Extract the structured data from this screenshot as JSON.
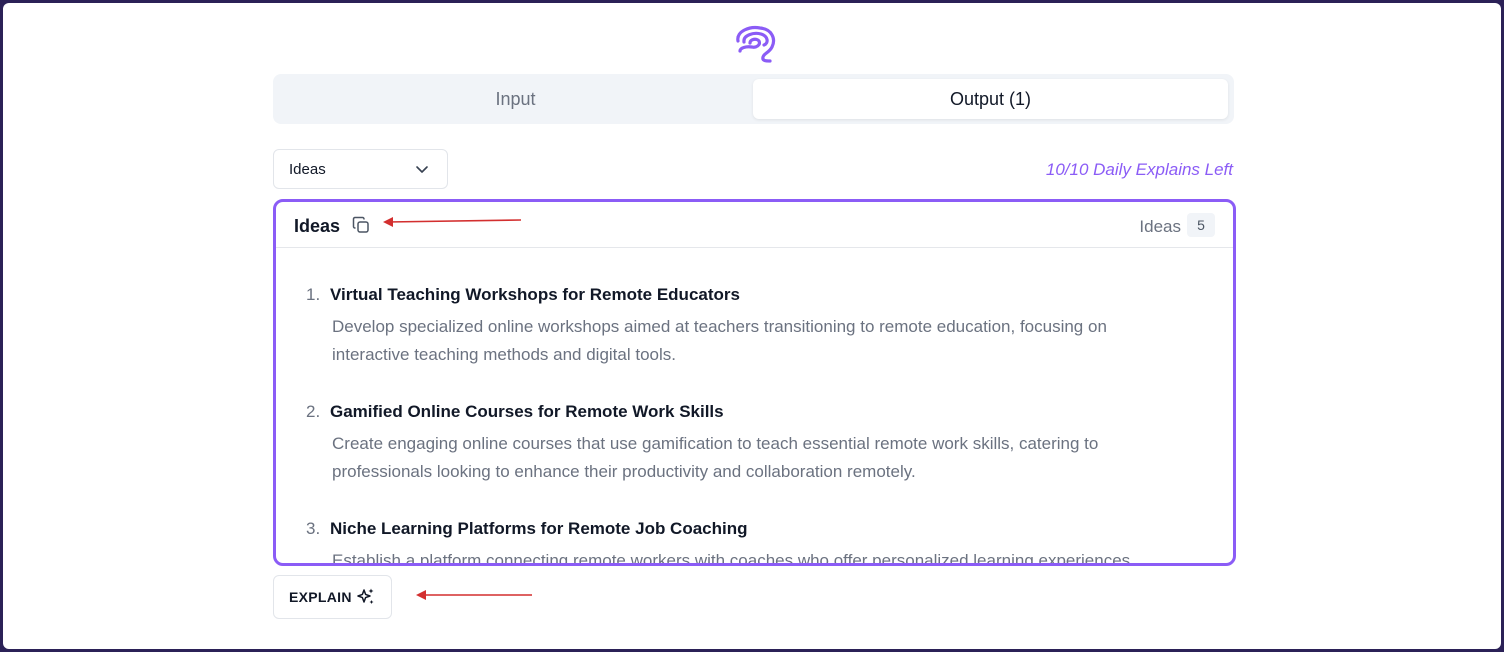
{
  "tabs": [
    {
      "label": "Input",
      "active": false
    },
    {
      "label": "Output (1)",
      "active": true
    }
  ],
  "selector": {
    "value": "Ideas"
  },
  "quota_text": "10/10 Daily Explains Left",
  "panel": {
    "title": "Ideas",
    "count_label": "Ideas",
    "count": "5",
    "items": [
      {
        "num": "1.",
        "title": "Virtual Teaching Workshops for Remote Educators",
        "desc": "Develop specialized online workshops aimed at teachers transitioning to remote education, focusing on interactive teaching methods and digital tools."
      },
      {
        "num": "2.",
        "title": "Gamified Online Courses for Remote Work Skills",
        "desc": "Create engaging online courses that use gamification to teach essential remote work skills, catering to professionals looking to enhance their productivity and collaboration remotely."
      },
      {
        "num": "3.",
        "title": "Niche Learning Platforms for Remote Job Coaching",
        "desc": "Establish a platform connecting remote workers with coaches who offer personalized learning experiences and"
      }
    ]
  },
  "explain_button": {
    "label": "EXPLAIN"
  },
  "colors": {
    "accent": "#8b5cf6",
    "annotation_arrow": "#d32f2f"
  },
  "icons": [
    "brain-logo-icon",
    "chevron-down-icon",
    "copy-icon",
    "sparkle-icon"
  ]
}
